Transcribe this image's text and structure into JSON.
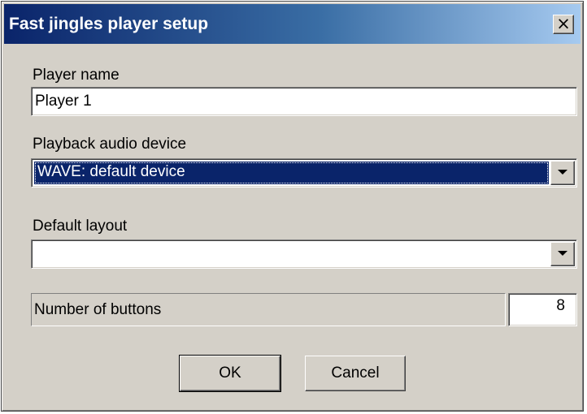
{
  "window": {
    "title": "Fast jingles player setup",
    "close_glyph": "×"
  },
  "player_name": {
    "label": "Player name",
    "value": "Player 1"
  },
  "playback_device": {
    "label": "Playback audio device",
    "selected": "WAVE: default device"
  },
  "default_layout": {
    "label": "Default layout",
    "selected": ""
  },
  "buttons_count": {
    "label": "Number of buttons",
    "value": "8"
  },
  "actions": {
    "ok_label": "OK",
    "cancel_label": "Cancel"
  },
  "colors": {
    "title_start": "#0a246a",
    "title_end": "#a6caf0",
    "face": "#d4d0c8",
    "selection": "#0a246a"
  }
}
